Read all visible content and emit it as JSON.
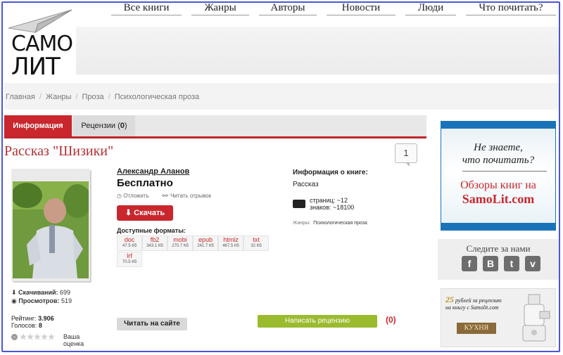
{
  "logo": {
    "line1": "САМО",
    "line2": "ЛИТ"
  },
  "nav": [
    "Все книги",
    "Жанры",
    "Авторы",
    "Новости",
    "Люди",
    "Что почитать?"
  ],
  "breadcrumbs": [
    "Главная",
    "Жанры",
    "Проза",
    "Психологическая проза"
  ],
  "tabs": {
    "info": "Информация",
    "reviews_label": "Рецензии (",
    "reviews_count": "0",
    "reviews_close": ")"
  },
  "book": {
    "title": "Рассказ \"Шизики\"",
    "comment_count": "1",
    "author": "Александр Аланов",
    "price": "Бесплатно",
    "postpone": "Отложить",
    "read_excerpt": "Читать отрывок",
    "download": "Скачать",
    "formats_label": "Доступные форматы:",
    "formats": [
      {
        "name": "doc",
        "size": "47.5 Кб"
      },
      {
        "name": "fb2",
        "size": "343.1 Кб"
      },
      {
        "name": "mobi",
        "size": "270.7 Кб"
      },
      {
        "name": "epub",
        "size": "241.7 Кб"
      },
      {
        "name": "htmlz",
        "size": "467.5 Кб"
      },
      {
        "name": "txt",
        "size": "32 Кб"
      },
      {
        "name": "lrf",
        "size": "70.5 Кб"
      }
    ],
    "downloads_label": "Скачиваний:",
    "downloads": "699",
    "views_label": "Просмотров:",
    "views": "519",
    "rating_label": "Рейтинг:",
    "rating": "3.906",
    "votes_label": "Голосов:",
    "votes": "8",
    "your_rating": "Ваша",
    "your_rating2": "оценка",
    "read_on_site": "Читать на сайте",
    "info_heading": "Информация о книге:",
    "genre_type": "Рассказ",
    "pages": "страниц: ~12",
    "chars": "знаков: ~18100",
    "genres_label": "Жанры:",
    "genres_value": "Психологическая проза",
    "write_review": "Написать рецензию",
    "reviews_count": "(0)"
  },
  "sidebar": {
    "promo_q1": "Не знаете,",
    "promo_q2": "что почитать?",
    "promo_b1": "Обзоры книг на",
    "promo_b2": "SamoLit.com",
    "follow": "Следите за нами",
    "social": [
      "f",
      "B",
      "t",
      "v"
    ],
    "ad_amount": "25",
    "ad_line1": "рублей за рецензию",
    "ad_line2": "на книгу с Samolit.com",
    "ad_kitchen": "КУХНЯ"
  },
  "colors": {
    "accent_red": "#c9272d",
    "accent_green": "#9bbb2e",
    "frame_blue": "#4a56d8"
  }
}
